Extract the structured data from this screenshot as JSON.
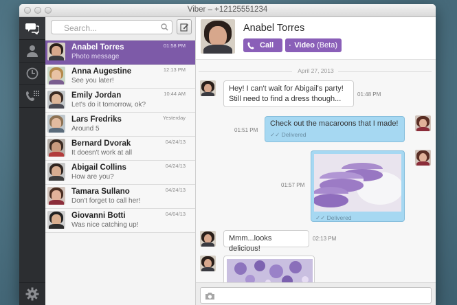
{
  "window": {
    "title": "Viber – +12125551234"
  },
  "search": {
    "placeholder": "Search..."
  },
  "contacts": [
    {
      "name": "Anabel Torres",
      "message": "Photo message",
      "time": "01:58 PM",
      "active": true,
      "bg": "#d6cfc4",
      "hair": "#2a1f1a",
      "skin": "#d7a78c",
      "body": "#3a3a40"
    },
    {
      "name": "Anna Augestine",
      "message": "See you later!",
      "time": "12:13 PM",
      "active": false,
      "bg": "#c9d6c5",
      "hair": "#b58a4c",
      "skin": "#e8c2a4",
      "body": "#7a5d8f"
    },
    {
      "name": "Emily Jordan",
      "message": "Let's do it tomorrow, ok?",
      "time": "10:44 AM",
      "active": false,
      "bg": "#c3c7c9",
      "hair": "#3b2b23",
      "skin": "#dcb598",
      "body": "#4b4b55"
    },
    {
      "name": "Lars Fredriks",
      "message": "Around 5",
      "time": "Yesterday",
      "active": false,
      "bg": "#bfc7cc",
      "hair": "#8e7355",
      "skin": "#e2bba0",
      "body": "#5a6b7b"
    },
    {
      "name": "Bernard Dvorak",
      "message": "It doesn't work at all",
      "time": "04/24/13",
      "active": false,
      "bg": "#b8b2ac",
      "hair": "#3a2a22",
      "skin": "#c99a7e",
      "body": "#b23c3c"
    },
    {
      "name": "Abigail Collins",
      "message": "How are you?",
      "time": "04/24/13",
      "active": false,
      "bg": "#c6c6c6",
      "hair": "#2f2520",
      "skin": "#d6ac90",
      "body": "#3d3d3d"
    },
    {
      "name": "Tamara Sullano",
      "message": "Don't forget to call her!",
      "time": "04/24/13",
      "active": false,
      "bg": "#d2c4bc",
      "hair": "#4a2e22",
      "skin": "#e1b29a",
      "body": "#8b2d3a"
    },
    {
      "name": "Giovanni Botti",
      "message": "Was nice catching up!",
      "time": "04/04/13",
      "active": false,
      "bg": "#d0d0d0",
      "hair": "#222",
      "skin": "#d9ae8f",
      "body": "#2d2d2d"
    }
  ],
  "chat": {
    "contact_name": "Anabel Torres",
    "call_label": "Call",
    "video_label": "Video",
    "video_beta": "(Beta)",
    "date": "April 27, 2013",
    "messages": [
      {
        "text_line1": "Hey! I can't wait for Abigail's party!",
        "text_line2": "Still need to find a dress though...",
        "time": "01:48 PM"
      },
      {
        "text": "Check out the macaroons that I made!",
        "status": "Delivered",
        "time": "01:51 PM"
      },
      {
        "status": "Delivered",
        "time": "01:57 PM"
      },
      {
        "text": "Mmm...looks delicious!",
        "time": "02:13 PM"
      }
    ],
    "composer_placeholder": ""
  },
  "colors": {
    "accent": "#8a5fb8",
    "active_row": "#7d5aa8",
    "my_bubble": "#a6d8f2"
  }
}
